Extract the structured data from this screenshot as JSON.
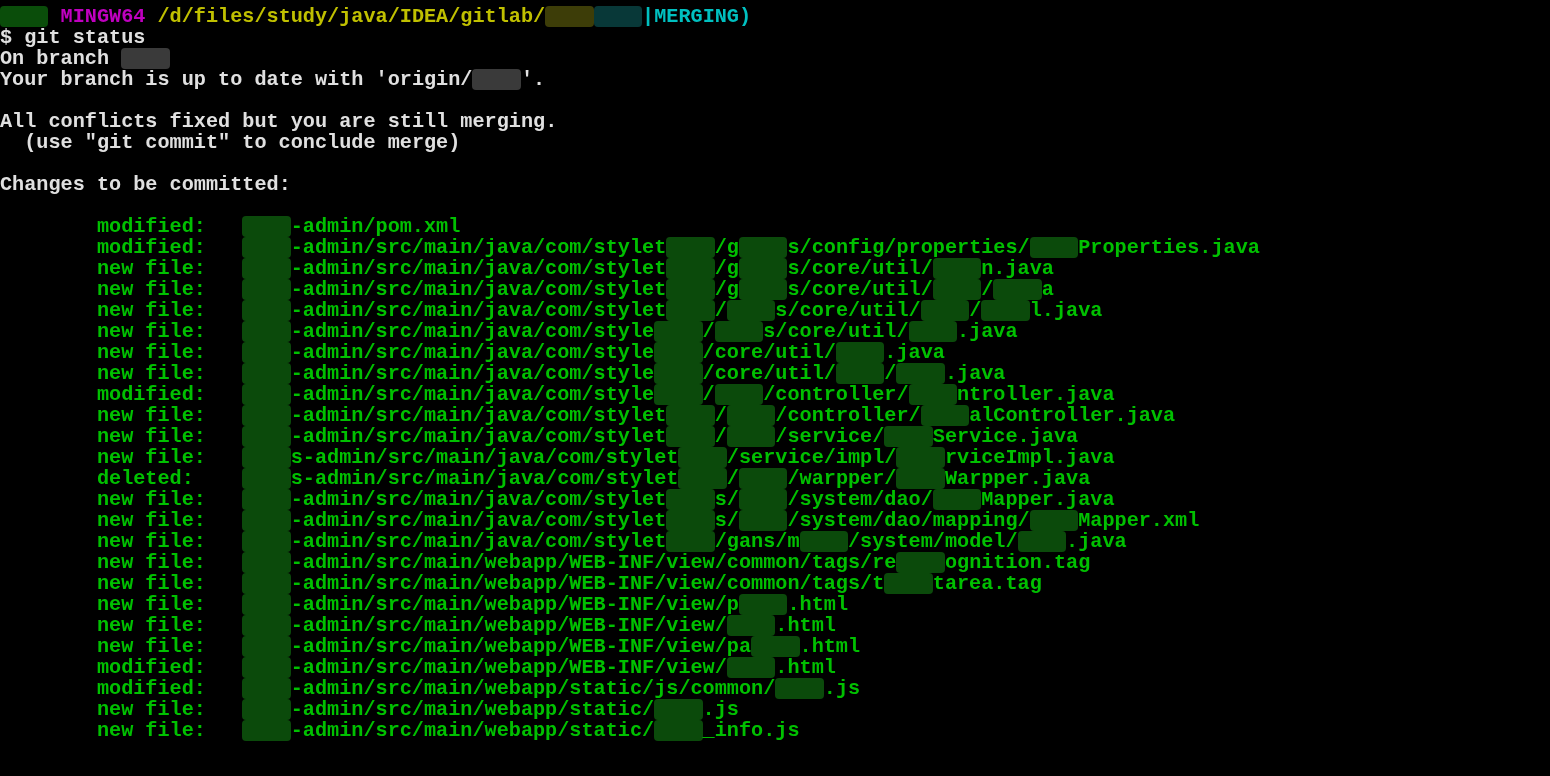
{
  "header_lines": [
    {
      "segments": [
        {
          "kind": "redacted",
          "color": "#0a4d0a"
        },
        {
          "kind": "text",
          "text": "MINGW64",
          "color": "#c000c0",
          "pad": true
        },
        {
          "kind": "text",
          "text": "/d/files/study/java/IDEA/gitlab/",
          "color": "#c0c000",
          "pad": true
        },
        {
          "kind": "redacted",
          "color": "#3d3d08"
        },
        {
          "kind": "redacted",
          "color": "#083838"
        },
        {
          "kind": "text",
          "text": "|MERGING)",
          "color": "#00c0c0"
        }
      ]
    },
    {
      "segments": [
        {
          "kind": "text",
          "text": "$ git status",
          "color": "#e0e0e0"
        }
      ]
    },
    {
      "segments": [
        {
          "kind": "text",
          "text": "On branch",
          "color": "#e0e0e0"
        },
        {
          "kind": "redacted",
          "color": "#3a3a3a",
          "pad": true
        }
      ]
    },
    {
      "segments": [
        {
          "kind": "text",
          "text": "Your branch is up to date with 'origin/",
          "color": "#e0e0e0"
        },
        {
          "kind": "redacted",
          "color": "#3a3a3a"
        },
        {
          "kind": "text",
          "text": "'.",
          "color": "#e0e0e0"
        }
      ]
    },
    {
      "kind": "blank"
    },
    {
      "segments": [
        {
          "kind": "text",
          "text": "All conflicts fixed but you are still merging.",
          "color": "#e0e0e0"
        }
      ]
    },
    {
      "indent": true,
      "segments": [
        {
          "kind": "text",
          "text": "(use \"git commit\" to conclude merge)",
          "color": "#e0e0e0"
        }
      ]
    },
    {
      "kind": "blank"
    },
    {
      "segments": [
        {
          "kind": "text",
          "text": "Changes to be committed:",
          "color": "#e0e0e0"
        }
      ]
    },
    {
      "kind": "blank"
    }
  ],
  "files": [
    {
      "status": "modified:",
      "parts": [
        {
          "kind": "redacted"
        },
        {
          "kind": "text",
          "text": "-admin/pom.xml"
        }
      ]
    },
    {
      "status": "modified:",
      "parts": [
        {
          "kind": "redacted"
        },
        {
          "kind": "text",
          "text": "-admin/src/main/java/com/stylet"
        },
        {
          "kind": "redacted"
        },
        {
          "kind": "text",
          "text": "/g"
        },
        {
          "kind": "redacted"
        },
        {
          "kind": "text",
          "text": "s/config/properties/"
        },
        {
          "kind": "redacted"
        },
        {
          "kind": "text",
          "text": "Properties.java"
        }
      ]
    },
    {
      "status": "new file:",
      "parts": [
        {
          "kind": "redacted"
        },
        {
          "kind": "text",
          "text": "-admin/src/main/java/com/stylet"
        },
        {
          "kind": "redacted"
        },
        {
          "kind": "text",
          "text": "/g"
        },
        {
          "kind": "redacted"
        },
        {
          "kind": "text",
          "text": "s/core/util/"
        },
        {
          "kind": "redacted"
        },
        {
          "kind": "text",
          "text": "n.java"
        }
      ]
    },
    {
      "status": "new file:",
      "parts": [
        {
          "kind": "redacted"
        },
        {
          "kind": "text",
          "text": "-admin/src/main/java/com/stylet"
        },
        {
          "kind": "redacted"
        },
        {
          "kind": "text",
          "text": "/g"
        },
        {
          "kind": "redacted"
        },
        {
          "kind": "text",
          "text": "s/core/util/"
        },
        {
          "kind": "redacted"
        },
        {
          "kind": "text",
          "text": "/"
        },
        {
          "kind": "redacted"
        },
        {
          "kind": "text",
          "text": "a"
        }
      ]
    },
    {
      "status": "new file:",
      "parts": [
        {
          "kind": "redacted"
        },
        {
          "kind": "text",
          "text": "-admin/src/main/java/com/stylet"
        },
        {
          "kind": "redacted"
        },
        {
          "kind": "text",
          "text": "/"
        },
        {
          "kind": "redacted"
        },
        {
          "kind": "text",
          "text": "s/core/util/"
        },
        {
          "kind": "redacted"
        },
        {
          "kind": "text",
          "text": "/"
        },
        {
          "kind": "redacted"
        },
        {
          "kind": "text",
          "text": "l.java"
        }
      ]
    },
    {
      "status": "new file:",
      "parts": [
        {
          "kind": "redacted"
        },
        {
          "kind": "text",
          "text": "-admin/src/main/java/com/style"
        },
        {
          "kind": "redacted"
        },
        {
          "kind": "text",
          "text": "/"
        },
        {
          "kind": "redacted"
        },
        {
          "kind": "text",
          "text": "s/core/util/"
        },
        {
          "kind": "redacted"
        },
        {
          "kind": "text",
          "text": ".java"
        }
      ]
    },
    {
      "status": "new file:",
      "parts": [
        {
          "kind": "redacted"
        },
        {
          "kind": "text",
          "text": "-admin/src/main/java/com/style"
        },
        {
          "kind": "redacted"
        },
        {
          "kind": "text",
          "text": "/core/util/"
        },
        {
          "kind": "redacted"
        },
        {
          "kind": "text",
          "text": ".java"
        }
      ]
    },
    {
      "status": "new file:",
      "parts": [
        {
          "kind": "redacted"
        },
        {
          "kind": "text",
          "text": "-admin/src/main/java/com/style"
        },
        {
          "kind": "redacted"
        },
        {
          "kind": "text",
          "text": "/core/util/"
        },
        {
          "kind": "redacted"
        },
        {
          "kind": "text",
          "text": "/"
        },
        {
          "kind": "redacted"
        },
        {
          "kind": "text",
          "text": ".java"
        }
      ]
    },
    {
      "status": "modified:",
      "parts": [
        {
          "kind": "redacted"
        },
        {
          "kind": "text",
          "text": "-admin/src/main/java/com/style"
        },
        {
          "kind": "redacted"
        },
        {
          "kind": "text",
          "text": "/"
        },
        {
          "kind": "redacted"
        },
        {
          "kind": "text",
          "text": "/controller/"
        },
        {
          "kind": "redacted"
        },
        {
          "kind": "text",
          "text": "ntroller.java"
        }
      ]
    },
    {
      "status": "new file:",
      "parts": [
        {
          "kind": "redacted"
        },
        {
          "kind": "text",
          "text": "-admin/src/main/java/com/stylet"
        },
        {
          "kind": "redacted"
        },
        {
          "kind": "text",
          "text": "/"
        },
        {
          "kind": "redacted"
        },
        {
          "kind": "text",
          "text": "/controller/"
        },
        {
          "kind": "redacted"
        },
        {
          "kind": "text",
          "text": "alController.java"
        }
      ]
    },
    {
      "status": "new file:",
      "parts": [
        {
          "kind": "redacted"
        },
        {
          "kind": "text",
          "text": "-admin/src/main/java/com/stylet"
        },
        {
          "kind": "redacted"
        },
        {
          "kind": "text",
          "text": "/"
        },
        {
          "kind": "redacted"
        },
        {
          "kind": "text",
          "text": "/service/"
        },
        {
          "kind": "redacted"
        },
        {
          "kind": "text",
          "text": "Service.java"
        }
      ]
    },
    {
      "status": "new file:",
      "parts": [
        {
          "kind": "redacted"
        },
        {
          "kind": "text",
          "text": "s-admin/src/main/java/com/stylet"
        },
        {
          "kind": "redacted"
        },
        {
          "kind": "text",
          "text": "/service/impl/"
        },
        {
          "kind": "redacted"
        },
        {
          "kind": "text",
          "text": "rviceImpl.java"
        }
      ]
    },
    {
      "status": "deleted:",
      "parts": [
        {
          "kind": "redacted"
        },
        {
          "kind": "text",
          "text": "s-admin/src/main/java/com/stylet"
        },
        {
          "kind": "redacted"
        },
        {
          "kind": "text",
          "text": "/"
        },
        {
          "kind": "redacted"
        },
        {
          "kind": "text",
          "text": "/warpper/"
        },
        {
          "kind": "redacted"
        },
        {
          "kind": "text",
          "text": "Warpper.java"
        }
      ]
    },
    {
      "status": "new file:",
      "parts": [
        {
          "kind": "redacted"
        },
        {
          "kind": "text",
          "text": "-admin/src/main/java/com/stylet"
        },
        {
          "kind": "redacted"
        },
        {
          "kind": "text",
          "text": "s/"
        },
        {
          "kind": "redacted"
        },
        {
          "kind": "text",
          "text": "/system/dao/"
        },
        {
          "kind": "redacted"
        },
        {
          "kind": "text",
          "text": "Mapper.java"
        }
      ]
    },
    {
      "status": "new file:",
      "parts": [
        {
          "kind": "redacted"
        },
        {
          "kind": "text",
          "text": "-admin/src/main/java/com/stylet"
        },
        {
          "kind": "redacted"
        },
        {
          "kind": "text",
          "text": "s/"
        },
        {
          "kind": "redacted"
        },
        {
          "kind": "text",
          "text": "/system/dao/mapping/"
        },
        {
          "kind": "redacted"
        },
        {
          "kind": "text",
          "text": "Mapper.xml"
        }
      ]
    },
    {
      "status": "new file:",
      "parts": [
        {
          "kind": "redacted"
        },
        {
          "kind": "text",
          "text": "-admin/src/main/java/com/stylet"
        },
        {
          "kind": "redacted"
        },
        {
          "kind": "text",
          "text": "/gans/m"
        },
        {
          "kind": "redacted"
        },
        {
          "kind": "text",
          "text": "/system/model/"
        },
        {
          "kind": "redacted"
        },
        {
          "kind": "text",
          "text": ".java"
        }
      ]
    },
    {
      "status": "new file:",
      "parts": [
        {
          "kind": "redacted"
        },
        {
          "kind": "text",
          "text": "-admin/src/main/webapp/WEB-INF/view/common/tags/re"
        },
        {
          "kind": "redacted"
        },
        {
          "kind": "text",
          "text": "ognition.tag"
        }
      ]
    },
    {
      "status": "new file:",
      "parts": [
        {
          "kind": "redacted"
        },
        {
          "kind": "text",
          "text": "-admin/src/main/webapp/WEB-INF/view/common/tags/t"
        },
        {
          "kind": "redacted"
        },
        {
          "kind": "text",
          "text": "tarea.tag"
        }
      ]
    },
    {
      "status": "new file:",
      "parts": [
        {
          "kind": "redacted"
        },
        {
          "kind": "text",
          "text": "-admin/src/main/webapp/WEB-INF/view/p"
        },
        {
          "kind": "redacted"
        },
        {
          "kind": "text",
          "text": ".html"
        }
      ]
    },
    {
      "status": "new file:",
      "parts": [
        {
          "kind": "redacted"
        },
        {
          "kind": "text",
          "text": "-admin/src/main/webapp/WEB-INF/view/"
        },
        {
          "kind": "redacted"
        },
        {
          "kind": "text",
          "text": ".html"
        }
      ]
    },
    {
      "status": "new file:",
      "parts": [
        {
          "kind": "redacted"
        },
        {
          "kind": "text",
          "text": "-admin/src/main/webapp/WEB-INF/view/pa"
        },
        {
          "kind": "redacted"
        },
        {
          "kind": "text",
          "text": ".html"
        }
      ]
    },
    {
      "status": "modified:",
      "parts": [
        {
          "kind": "redacted"
        },
        {
          "kind": "text",
          "text": "-admin/src/main/webapp/WEB-INF/view/"
        },
        {
          "kind": "redacted"
        },
        {
          "kind": "text",
          "text": ".html"
        }
      ]
    },
    {
      "status": "modified:",
      "parts": [
        {
          "kind": "redacted"
        },
        {
          "kind": "text",
          "text": "-admin/src/main/webapp/static/js/common/"
        },
        {
          "kind": "redacted"
        },
        {
          "kind": "text",
          "text": ".js"
        }
      ]
    },
    {
      "status": "new file:",
      "parts": [
        {
          "kind": "redacted"
        },
        {
          "kind": "text",
          "text": "-admin/src/main/webapp/static/"
        },
        {
          "kind": "redacted"
        },
        {
          "kind": "text",
          "text": ".js"
        }
      ]
    },
    {
      "status": "new file:",
      "parts": [
        {
          "kind": "redacted"
        },
        {
          "kind": "text",
          "text": "-admin/src/main/webapp/static/"
        },
        {
          "kind": "redacted"
        },
        {
          "kind": "text",
          "text": "_info.js"
        }
      ]
    }
  ]
}
